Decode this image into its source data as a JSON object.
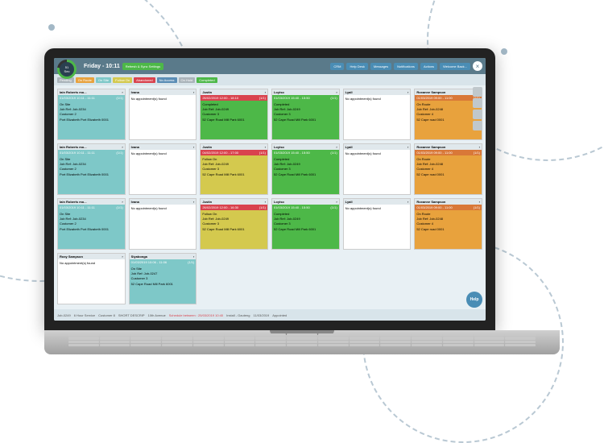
{
  "timer": {
    "value": "51",
    "unit": "Sec"
  },
  "header": {
    "day_time": "Friday - 10:11",
    "settings_btn": "Refresh & Sync Settings"
  },
  "top_nav": [
    {
      "label": "CRM"
    },
    {
      "label": "Help Desk"
    },
    {
      "label": "Messages"
    },
    {
      "label": "Notifications"
    },
    {
      "label": "Actions"
    },
    {
      "label": "Welcome Back..."
    }
  ],
  "statuses": [
    {
      "label": "Pending",
      "color": "bg-grey"
    },
    {
      "label": "On Route",
      "color": "bg-orange"
    },
    {
      "label": "On Site",
      "color": "bg-teal"
    },
    {
      "label": "Follow On",
      "color": "bg-yellow"
    },
    {
      "label": "Abandoned",
      "color": "bg-red"
    },
    {
      "label": "No Access",
      "color": "bg-blue"
    },
    {
      "label": "On Hold",
      "color": "bg-grey"
    },
    {
      "label": "Completed",
      "color": "bg-green"
    }
  ],
  "cards": [
    {
      "worker": "Iain Roberts mo...",
      "date": "01/03/2019 10:11 - 11:11",
      "date_color": "bg-teal",
      "body_color": "bg-teal",
      "status": "On Site",
      "job": "Job Ref: Job-0234",
      "cust": "Customer 2",
      "addr": "Port Elizabeth Port Elizabeth 0001",
      "count": "(1/1)"
    },
    {
      "worker": "Ivana",
      "date": "",
      "date_color": "",
      "body_color": "",
      "status": "No appointment(s) found",
      "job": "",
      "cust": "",
      "addr": "",
      "count": ""
    },
    {
      "worker": "Justin",
      "date": "26/02/2019 12:00 - 18:10",
      "date_color": "bg-red",
      "body_color": "bg-green",
      "status": "Completed",
      "job": "Job Ref: Job-0249",
      "cust": "Customer 3",
      "addr": "52 Cape Road Mill Park 6001",
      "count": "(1/1)"
    },
    {
      "worker": "Loyiso",
      "date": "01/03/2019 15:40 - 15:50",
      "date_color": "bg-green",
      "body_color": "bg-green",
      "status": "Completed",
      "job": "Job Ref: Job-0249",
      "cust": "Customer 3",
      "addr": "52 Cape Road Mill Park 6001",
      "count": "(1/1)"
    },
    {
      "worker": "Lyall",
      "date": "",
      "date_color": "",
      "body_color": "",
      "status": "No appointment(s) found",
      "job": "",
      "cust": "",
      "addr": "",
      "count": ""
    },
    {
      "worker": "Roxanne Sampson",
      "date": "01/03/2019 09:00 - 11:00",
      "date_color": "bg-darkorange",
      "body_color": "bg-orange",
      "status": "On Route",
      "job": "Job Ref: Job-0248",
      "cust": "Customer 4",
      "addr": "52 Cape road 0001",
      "count": "(1/1)"
    },
    {
      "worker": "Iain Roberts mo...",
      "date": "01/03/2019 10:11 - 11:11",
      "date_color": "bg-teal",
      "body_color": "bg-teal",
      "status": "On Site",
      "job": "Job Ref: Job-0234",
      "cust": "Customer 2",
      "addr": "Port Elizabeth Port Elizabeth 0001",
      "count": "(1/1)"
    },
    {
      "worker": "Ivana",
      "date": "",
      "date_color": "",
      "body_color": "",
      "status": "No appointment(s) found",
      "job": "",
      "cust": "",
      "addr": "",
      "count": ""
    },
    {
      "worker": "Justin",
      "date": "04/02/2019 12:00 - 17:00",
      "date_color": "bg-red",
      "body_color": "bg-yellow",
      "status": "Follow On",
      "job": "Job Ref: Job-0249",
      "cust": "Customer 3",
      "addr": "52 Cape Road Mill Park 6001",
      "count": "(1/1)"
    },
    {
      "worker": "Loyiso",
      "date": "01/03/2019 15:40 - 15:50",
      "date_color": "bg-green",
      "body_color": "bg-green",
      "status": "Completed",
      "job": "Job Ref: Job-0249",
      "cust": "Customer 3",
      "addr": "52 Cape Road Mill Park 6001",
      "count": "(1/1)"
    },
    {
      "worker": "Lyall",
      "date": "",
      "date_color": "",
      "body_color": "",
      "status": "No appointment(s) found",
      "job": "",
      "cust": "",
      "addr": "",
      "count": ""
    },
    {
      "worker": "Roxanne Sampson",
      "date": "01/03/2019 09:00 - 11:00",
      "date_color": "bg-darkorange",
      "body_color": "bg-orange",
      "status": "On Route",
      "job": "Job Ref: Job-0248",
      "cust": "Customer 4",
      "addr": "52 Cape road 0001",
      "count": "(1/1)"
    },
    {
      "worker": "Iain Roberts mo...",
      "date": "01/03/2019 10:11 - 11:11",
      "date_color": "bg-teal",
      "body_color": "bg-teal",
      "status": "On Site",
      "job": "Job Ref: Job-0234",
      "cust": "Customer 2",
      "addr": "Port Elizabeth Port Elizabeth 0001",
      "count": "(1/1)"
    },
    {
      "worker": "Ivana",
      "date": "",
      "date_color": "",
      "body_color": "",
      "status": "No appointment(s) found",
      "job": "",
      "cust": "",
      "addr": "",
      "count": ""
    },
    {
      "worker": "Justin",
      "date": "26/02/2019 12:00 - 16:30",
      "date_color": "bg-red",
      "body_color": "bg-yellow",
      "status": "Follow On",
      "job": "Job Ref: Job-0249",
      "cust": "Customer 3",
      "addr": "52 Cape Road Mill Park 6001",
      "count": "(1/1)"
    },
    {
      "worker": "Loyiso",
      "date": "01/03/2019 15:40 - 15:50",
      "date_color": "bg-green",
      "body_color": "bg-green",
      "status": "Completed",
      "job": "Job Ref: Job-0249",
      "cust": "Customer 3",
      "addr": "52 Cape Road Mill Park 6001",
      "count": "(1/1)"
    },
    {
      "worker": "Lyall",
      "date": "",
      "date_color": "",
      "body_color": "",
      "status": "No appointment(s) found",
      "job": "",
      "cust": "",
      "addr": "",
      "count": ""
    },
    {
      "worker": "Roxanne Sampson",
      "date": "01/03/2019 09:00 - 11:00",
      "date_color": "bg-darkorange",
      "body_color": "bg-orange",
      "status": "On Route",
      "job": "Job Ref: Job-0248",
      "cust": "Customer 4",
      "addr": "52 Cape road 0001",
      "count": "(1/1)"
    },
    {
      "worker": "Roxy Sampson",
      "date": "",
      "date_color": "",
      "body_color": "",
      "status": "No appointment(s) found",
      "job": "",
      "cust": "",
      "addr": "",
      "count": ""
    },
    {
      "worker": "Siyabonga",
      "date": "01/03/2019 10:06 - 11:06",
      "date_color": "bg-teal",
      "body_color": "bg-teal",
      "status": "On Site",
      "job": "Job Ref: Job-0247",
      "cust": "Customer 3",
      "addr": "52 Cape Road Mill Park 6001",
      "count": "(1/1)"
    }
  ],
  "bottom": {
    "items": [
      "Job-0249",
      "6 Hour Service",
      "Customer 8",
      "SHORT DESCRIP",
      "10th Avenue",
      "Install - Gauteng",
      "11/03/2019",
      "Appointed"
    ],
    "schedule": "Schedule between : 25/03/2019 10:40"
  },
  "help": "Help"
}
